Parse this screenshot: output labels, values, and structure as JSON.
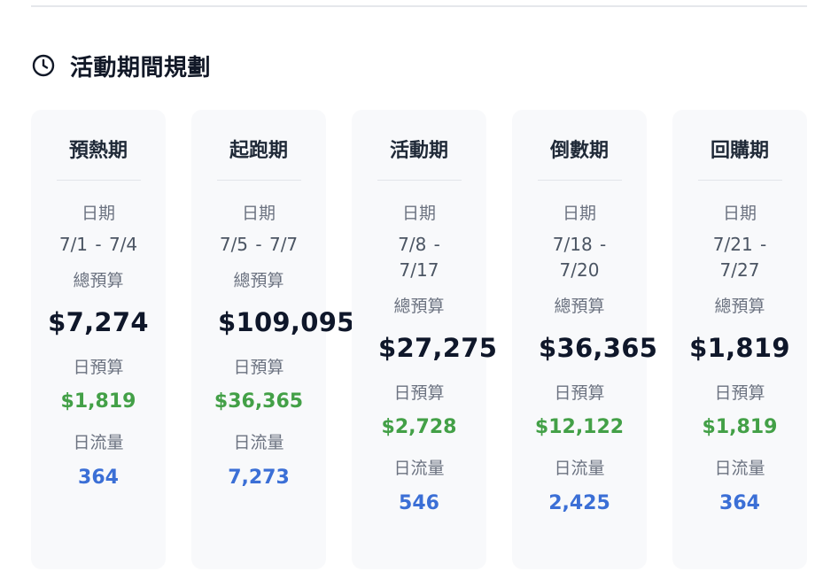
{
  "section": {
    "title": "活動期間規劃",
    "icon": "clock-icon"
  },
  "labels": {
    "date": "日期",
    "total_budget": "總預算",
    "daily_budget": "日預算",
    "daily_traffic": "日流量"
  },
  "colors": {
    "daily_budget": "#43a047",
    "daily_traffic": "#3b6fd6",
    "card_background": "#f8f9fb"
  },
  "phases": [
    {
      "name": "預熱期",
      "date": "7/1 - 7/4",
      "total_budget": "$7,274",
      "daily_budget": "$1,819",
      "daily_traffic": "364"
    },
    {
      "name": "起跑期",
      "date": "7/5 - 7/7",
      "total_budget": "$109,095",
      "daily_budget": "$36,365",
      "daily_traffic": "7,273"
    },
    {
      "name": "活動期",
      "date": "7/8 - 7/17",
      "total_budget": "$27,275",
      "daily_budget": "$2,728",
      "daily_traffic": "546"
    },
    {
      "name": "倒數期",
      "date": "7/18 - 7/20",
      "total_budget": "$36,365",
      "daily_budget": "$12,122",
      "daily_traffic": "2,425"
    },
    {
      "name": "回購期",
      "date": "7/21 - 7/27",
      "total_budget": "$1,819",
      "daily_budget": "$1,819",
      "daily_traffic": "364"
    }
  ]
}
